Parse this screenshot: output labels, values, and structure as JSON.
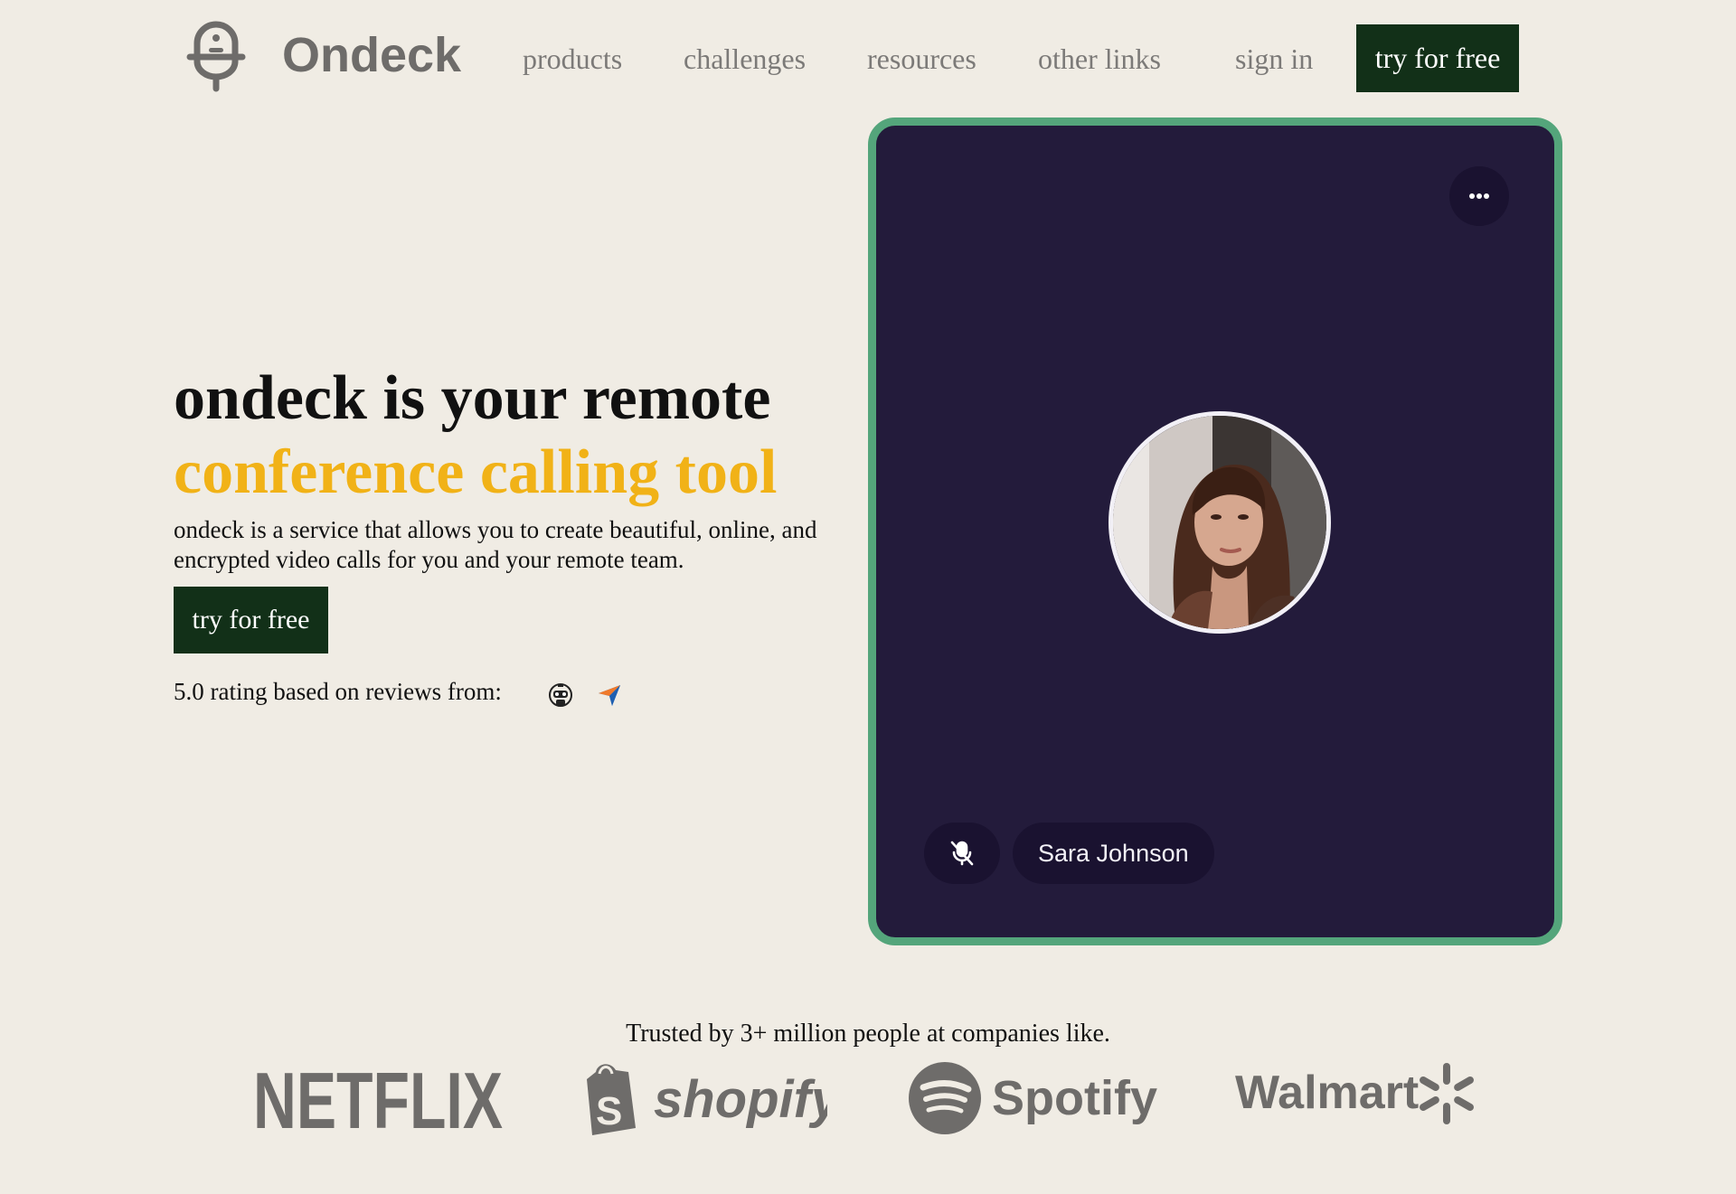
{
  "header": {
    "brand": "Ondeck",
    "nav": [
      "products",
      "challenges",
      "resources",
      "other links"
    ],
    "sign_in": "sign in",
    "cta": "try for free"
  },
  "hero": {
    "title_line1": "ondeck is your remote",
    "title_line2": "conference calling tool",
    "description": "ondeck is a service that allows you to create beautiful, online, and encrypted video calls for you and your remote team.",
    "cta": "try for free",
    "rating_text": "5.0 rating based on reviews from:",
    "review_icons": [
      "robot-icon",
      "paper-plane-icon"
    ]
  },
  "call": {
    "participant_name": "Sara Johnson",
    "mic_muted": true,
    "border_color": "#54a57b",
    "background_color": "#231b3b"
  },
  "trusted": {
    "text": "Trusted by 3+ million people at companies like.",
    "companies": [
      "NETFLIX",
      "shopify",
      "Spotify",
      "Walmart"
    ]
  },
  "colors": {
    "page_background": "#f0ece4",
    "accent": "#f1b217",
    "button": "#123018"
  }
}
